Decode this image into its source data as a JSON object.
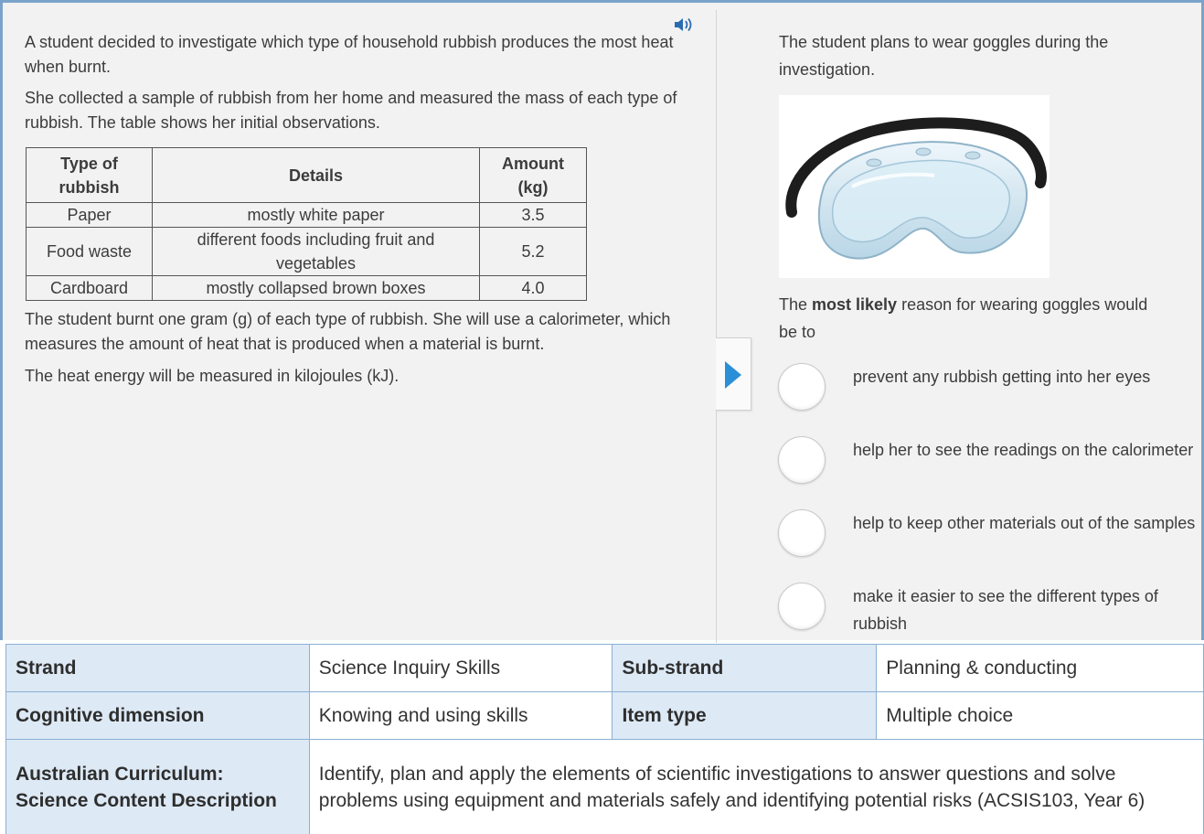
{
  "stimulus": {
    "paragraph_1": "A student decided to investigate which type of household rubbish produces the most heat when burnt.",
    "paragraph_2": "She collected a sample of rubbish from her home and measured the mass of each type of rubbish. The table shows her initial observations.",
    "paragraph_3": "The student burnt one gram (g) of each type of rubbish. She will use a calorimeter, which measures the amount of heat that is produced when a material is burnt.",
    "paragraph_4": "The heat energy will be measured in kilojoules (kJ).",
    "audio_icon": "speaker-icon",
    "table": {
      "headers": [
        "Type of rubbish",
        "Details",
        "Amount (kg)"
      ],
      "rows": [
        [
          "Paper",
          "mostly white paper",
          "3.5"
        ],
        [
          "Food waste",
          "different foods including fruit and vegetables",
          "5.2"
        ],
        [
          "Cardboard",
          "mostly collapsed brown boxes",
          "4.0"
        ]
      ]
    }
  },
  "question": {
    "intro": "The student plans to wear goggles during the investigation.",
    "image": "safety-goggles-photo",
    "stem_prefix": "The ",
    "stem_bold": "most likely",
    "stem_suffix": " reason for wearing goggles would be to",
    "options": [
      "prevent any rubbish getting into her eyes",
      "help her to see the readings on the calorimeter",
      "help to keep other materials out of the samples",
      "make it easier to see the different types of rubbish"
    ]
  },
  "navigation": {
    "next_icon": "triangle-right-icon",
    "accent": "#2b8fd8"
  },
  "metadata": {
    "strand_label": "Strand",
    "strand_value": "Science Inquiry Skills",
    "substrand_label": "Sub-strand",
    "substrand_value": "Planning & conducting",
    "cognitive_label": "Cognitive dimension",
    "cognitive_value": "Knowing and using skills",
    "itemtype_label": "Item type",
    "itemtype_value": "Multiple choice",
    "curriculum_label": "Australian Curriculum: Science Content Description",
    "curriculum_value": "Identify, plan and apply the elements of scientific investigations to answer questions and solve problems using equipment and materials safely and identifying potential risks (ACSIS103, Year 6)"
  },
  "colors": {
    "frame_border": "#7aa3c9",
    "label_bg": "#dde9f5",
    "pane_bg": "#f2f2f2"
  }
}
